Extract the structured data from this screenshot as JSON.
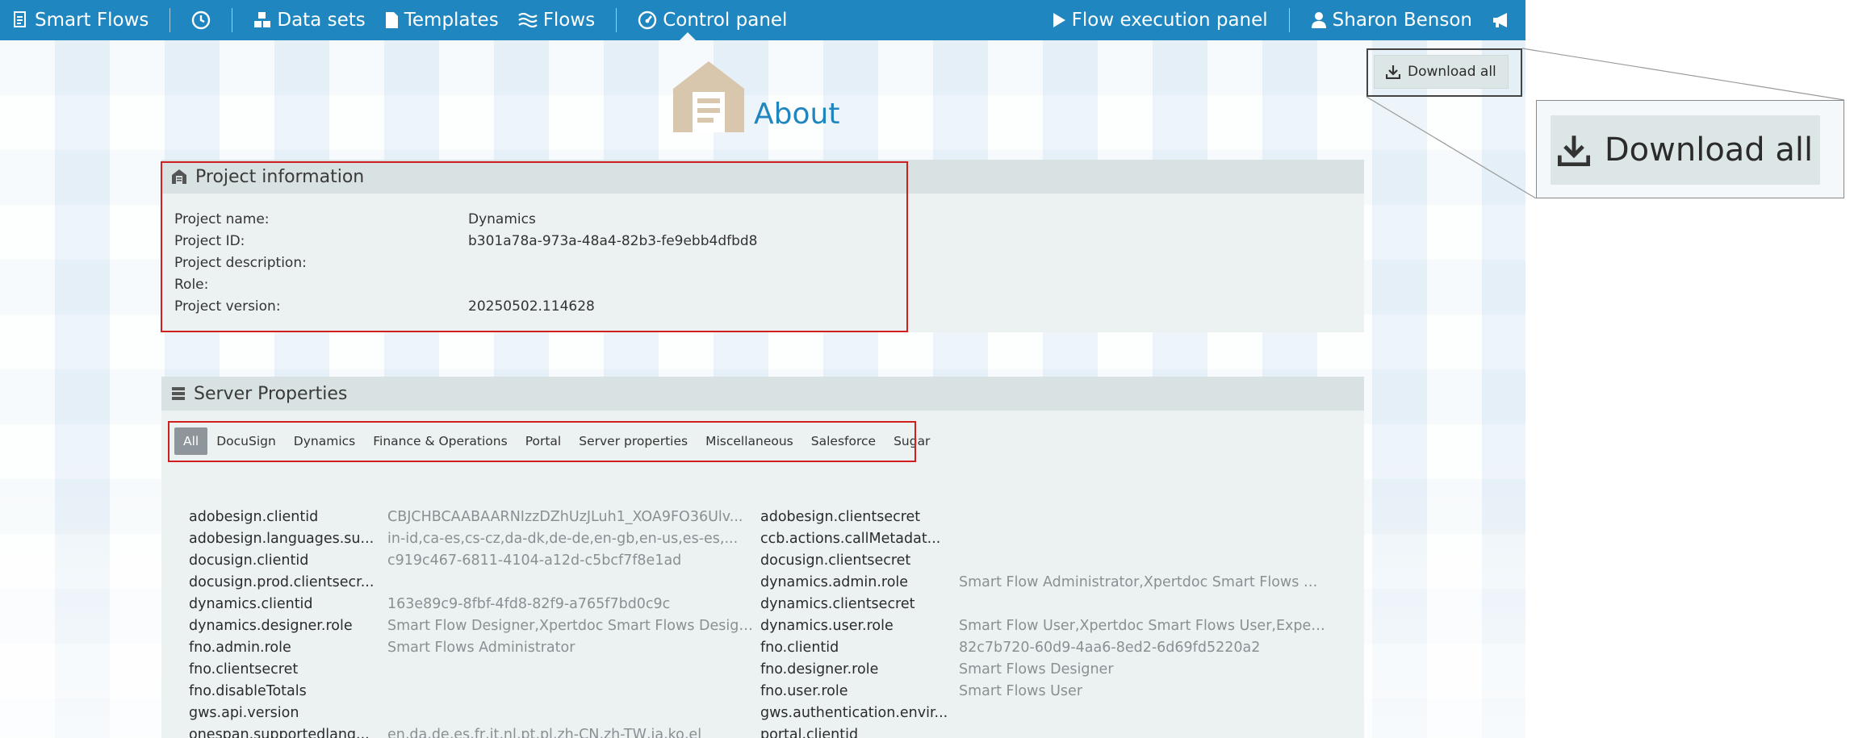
{
  "navbar": {
    "brand": "Smart Flows",
    "items": {
      "datasets": "Data sets",
      "templates": "Templates",
      "flows": "Flows",
      "control_panel": "Control panel",
      "flow_execution": "Flow execution panel",
      "user": "Sharon Benson"
    }
  },
  "page": {
    "title": "About"
  },
  "project": {
    "header": "Project information",
    "fields": [
      {
        "label": "Project name:",
        "value": "Dynamics"
      },
      {
        "label": "Project ID:",
        "value": "b301a78a-973a-48a4-82b3-fe9ebb4dfbd8"
      },
      {
        "label": "Project description:",
        "value": ""
      },
      {
        "label": "Role:",
        "value": ""
      },
      {
        "label": "Project version:",
        "value": "20250502.114628"
      }
    ]
  },
  "server": {
    "header": "Server Properties",
    "tabs": [
      "All",
      "DocuSign",
      "Dynamics",
      "Finance & Operations",
      "Portal",
      "Server properties",
      "Miscellaneous",
      "Salesforce",
      "Sugar"
    ],
    "rows": [
      [
        "adobesign.clientid",
        "CBJCHBCAABAARNIzzDZhUzJLuh1_XOA9FO36Ulv...",
        "adobesign.clientsecret",
        ""
      ],
      [
        "adobesign.languages.su...",
        "in-id,ca-es,cs-cz,da-dk,de-de,en-gb,en-us,es-es,...",
        "ccb.actions.callMetadat...",
        ""
      ],
      [
        "docusign.clientid",
        "c919c467-6811-4104-a12d-c5bcf7f8e1ad",
        "docusign.clientsecret",
        ""
      ],
      [
        "docusign.prod.clientsecr...",
        "",
        "dynamics.admin.role",
        "Smart Flow Administrator,Xpertdoc Smart Flows Ad..."
      ],
      [
        "dynamics.clientid",
        "163e89c9-8fbf-4fd8-82f9-a765f7bd0c9c",
        "dynamics.clientsecret",
        ""
      ],
      [
        "dynamics.designer.role",
        "Smart Flow Designer,Xpertdoc Smart Flows Design...",
        "dynamics.user.role",
        "Smart Flow User,Xpertdoc Smart Flows User,Experl..."
      ],
      [
        "fno.admin.role",
        "Smart Flows Administrator",
        "fno.clientid",
        "82c7b720-60d9-4aa6-8ed2-6d69fd5220a2"
      ],
      [
        "fno.clientsecret",
        "",
        "fno.designer.role",
        "Smart Flows Designer"
      ],
      [
        "fno.disableTotals",
        "",
        "fno.user.role",
        "Smart Flows User"
      ],
      [
        "gws.api.version",
        "",
        "gws.authentication.envir...",
        ""
      ],
      [
        "onespan.supportedlang...",
        "en,da,de,es,fr,it,nl,pt,pl,zh-CN,zh-TW,ja,ko,el",
        "portal.clientid",
        ""
      ]
    ]
  },
  "download": {
    "label": "Download all"
  },
  "colors": {
    "navbar": "#1f86bf",
    "highlight": "#d11f1f",
    "title": "#1f86bf"
  }
}
